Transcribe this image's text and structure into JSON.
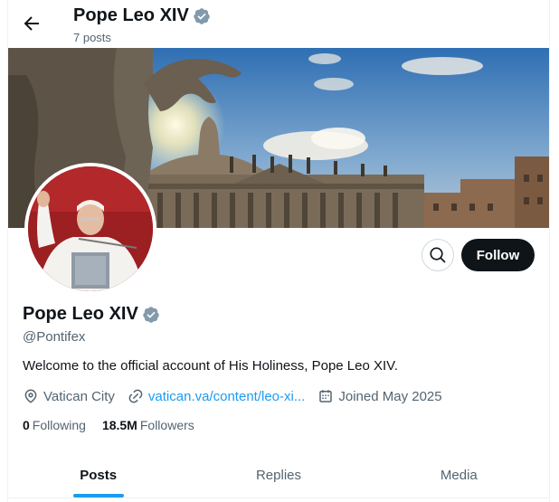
{
  "header": {
    "title": "Pope Leo XIV",
    "post_count": "7 posts"
  },
  "profile": {
    "name": "Pope Leo XIV",
    "handle": "@Pontifex",
    "bio": "Welcome to the official account of His Holiness, Pope Leo XIV.",
    "location": "Vatican City",
    "website": "vatican.va/content/leo-xi...",
    "joined": "Joined May 2025",
    "following_count": "0",
    "following_label": "Following",
    "followers_count": "18.5M",
    "followers_label": "Followers"
  },
  "actions": {
    "follow_label": "Follow"
  },
  "tabs": [
    {
      "label": "Posts",
      "active": true
    },
    {
      "label": "Replies",
      "active": false
    },
    {
      "label": "Media",
      "active": false
    }
  ],
  "colors": {
    "accent": "#1d9bf0",
    "verified": "#829aab",
    "text": "#0f1419",
    "muted": "#536471"
  }
}
